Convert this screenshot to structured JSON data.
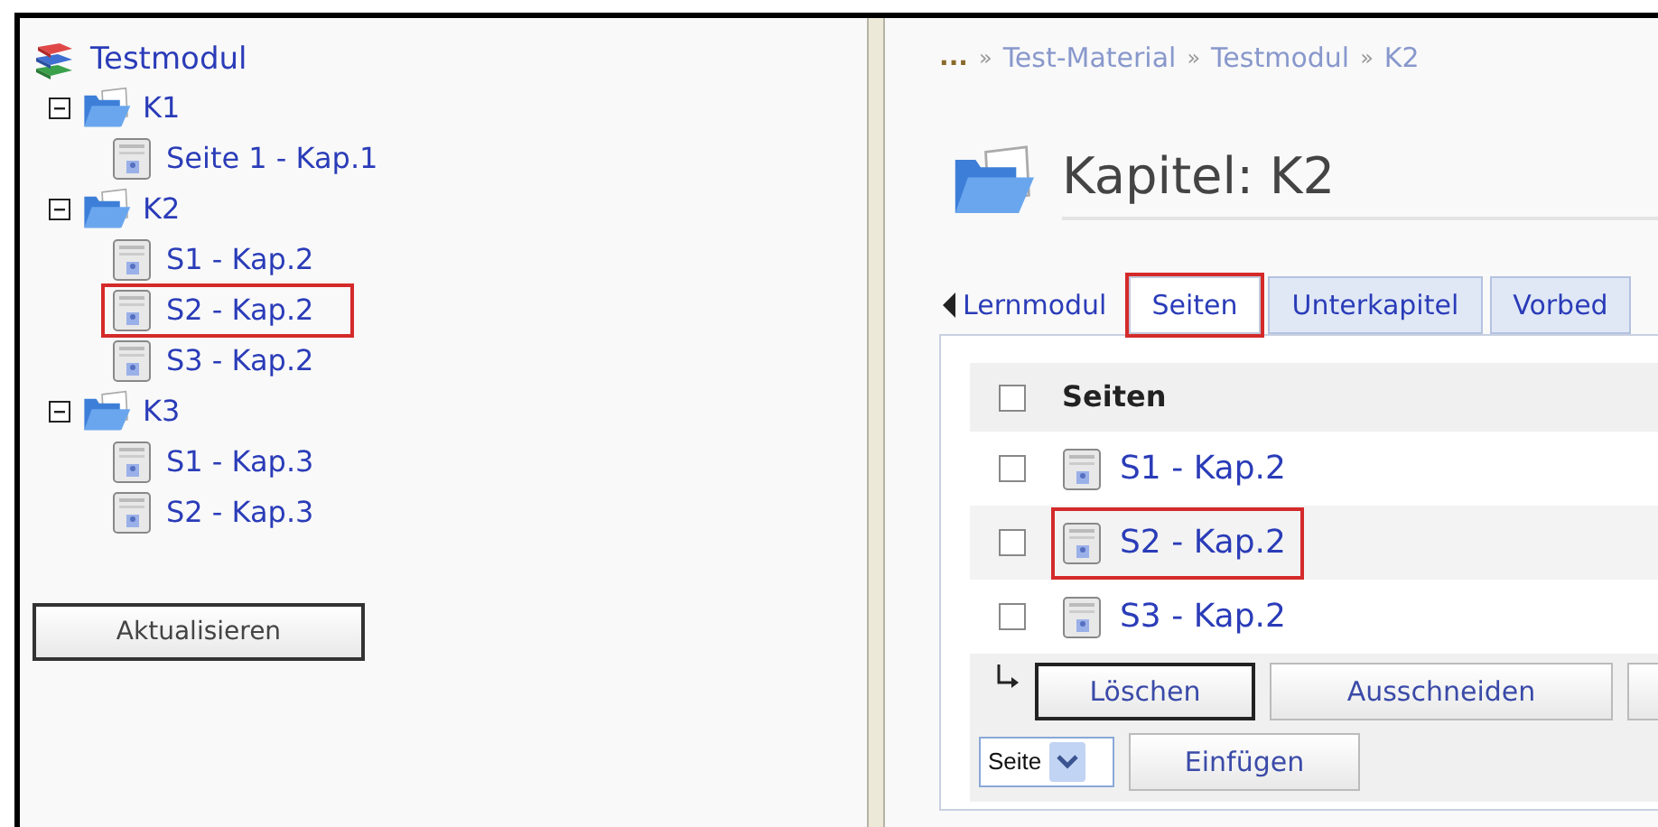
{
  "tree": {
    "label": "Testmodul",
    "children": [
      {
        "label": "K1",
        "expanded": true,
        "children": [
          {
            "label": "Seite 1 - Kap.1",
            "highlighted": false
          }
        ]
      },
      {
        "label": "K2",
        "expanded": true,
        "children": [
          {
            "label": "S1 - Kap.2",
            "highlighted": false
          },
          {
            "label": "S2 - Kap.2",
            "highlighted": true
          },
          {
            "label": "S3 - Kap.2",
            "highlighted": false
          }
        ]
      },
      {
        "label": "K3",
        "expanded": true,
        "children": [
          {
            "label": "S1 - Kap.3",
            "highlighted": false
          },
          {
            "label": "S2 - Kap.3",
            "highlighted": false
          }
        ]
      }
    ]
  },
  "refresh_button": "Aktualisieren",
  "breadcrumb": [
    {
      "kind": "ellipsis",
      "text": "..."
    },
    {
      "kind": "separator",
      "text": "»"
    },
    {
      "kind": "link",
      "text": "Test-Material"
    },
    {
      "kind": "separator",
      "text": "»"
    },
    {
      "kind": "link",
      "text": "Testmodul"
    },
    {
      "kind": "separator",
      "text": "»"
    },
    {
      "kind": "link",
      "text": "K2"
    }
  ],
  "heading": "Kapitel: K2",
  "tabs": [
    {
      "kind": "back",
      "label": "Lernmodul",
      "highlighted": false
    },
    {
      "kind": "tab",
      "label": "Seiten",
      "selected": true,
      "highlighted": true
    },
    {
      "kind": "tab",
      "label": "Unterkapitel",
      "selected": false,
      "highlighted": false
    },
    {
      "kind": "tab",
      "label": "Vorbed",
      "selected": false,
      "highlighted": false
    }
  ],
  "table": {
    "header": "Seiten",
    "header_checked": false,
    "rows": [
      {
        "label": "S1 - Kap.2",
        "checked": false,
        "highlighted": false
      },
      {
        "label": "S2 - Kap.2",
        "checked": false,
        "highlighted": true
      },
      {
        "label": "S3 - Kap.2",
        "checked": false,
        "highlighted": false
      }
    ]
  },
  "actions": [
    {
      "label": "Löschen",
      "kind": "default"
    },
    {
      "label": "Ausschneiden",
      "kind": "normal"
    },
    {
      "kind": "cut"
    }
  ],
  "insert": {
    "type_select": "Seite",
    "button": "Einfügen"
  }
}
